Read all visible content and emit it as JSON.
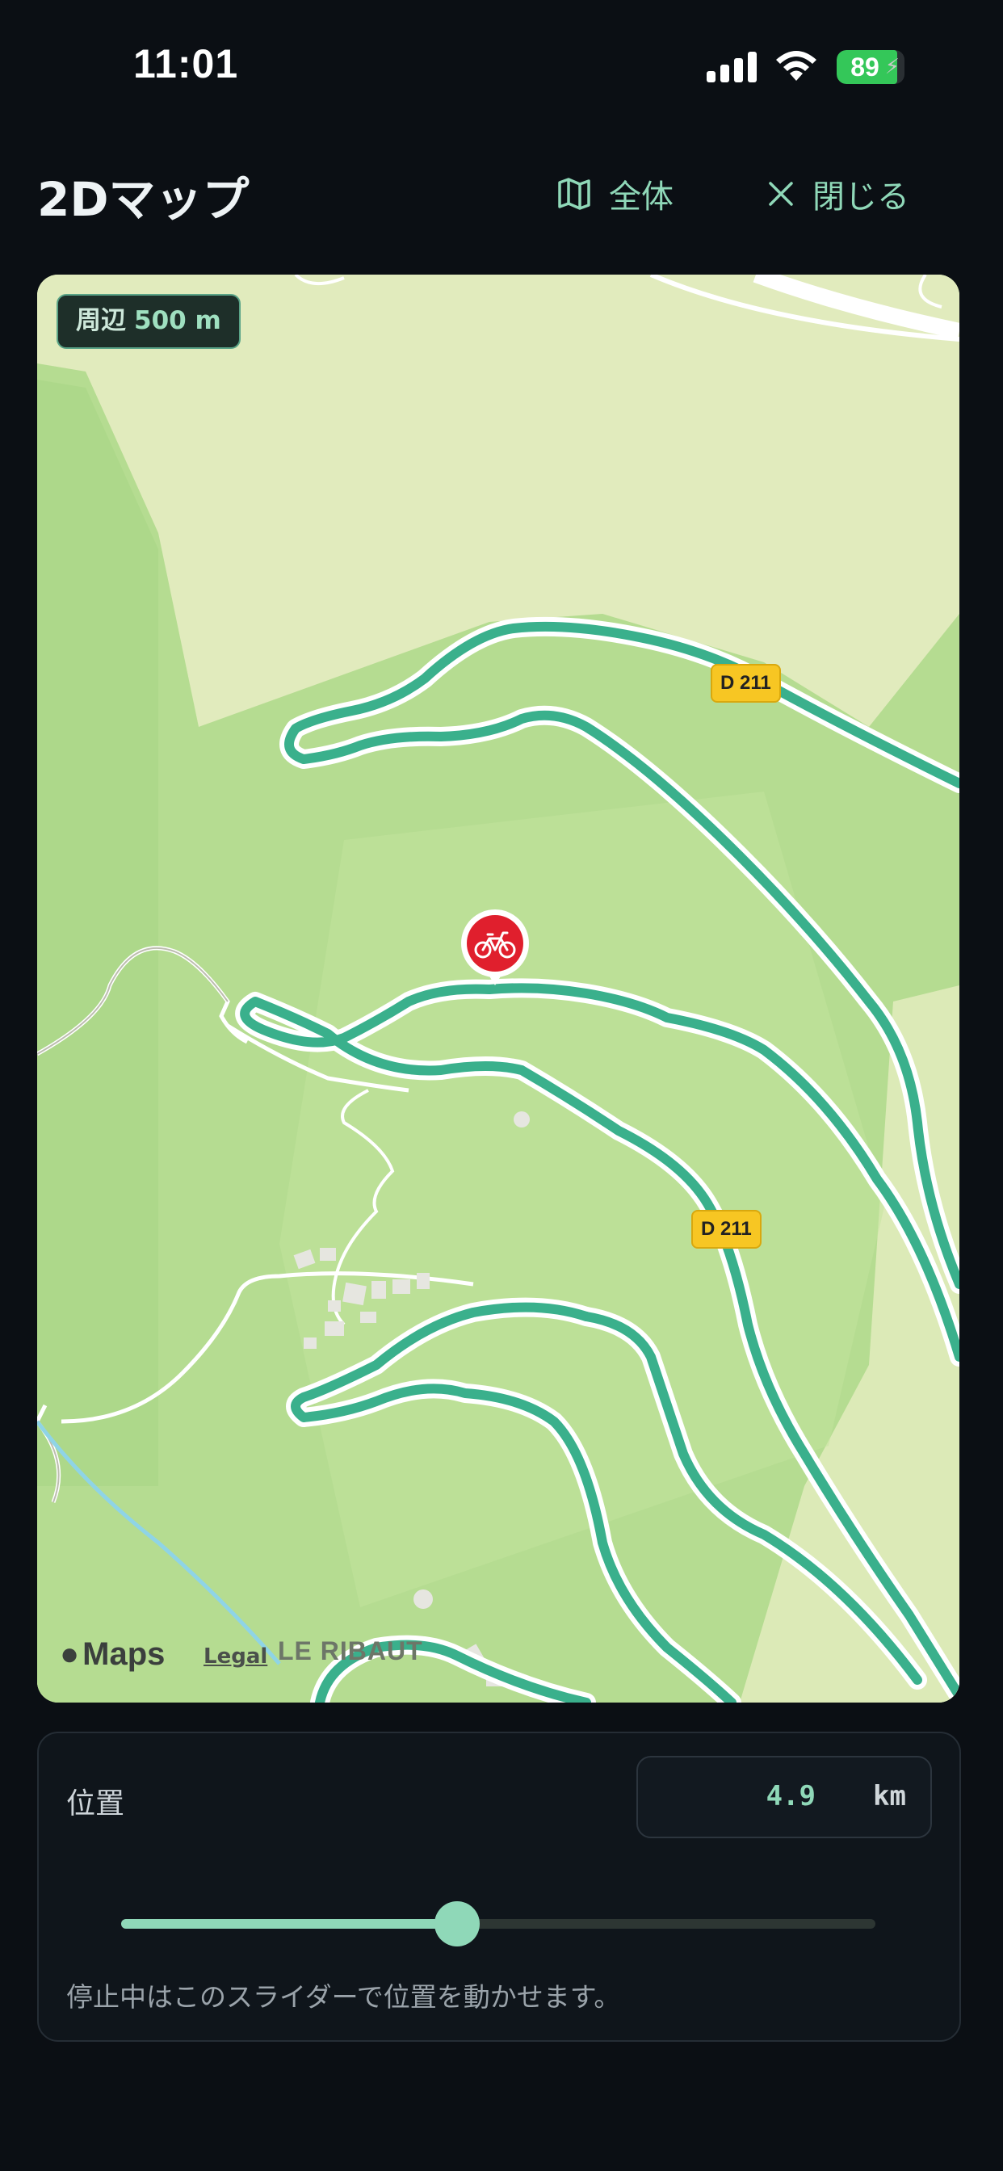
{
  "status_bar": {
    "time": "11:01",
    "battery": "89",
    "battery_level": 0.89
  },
  "header": {
    "title": "2Dマップ",
    "overview_label": "全体",
    "close_label": "閉じる"
  },
  "map": {
    "radius_label": "周辺",
    "radius_value": "500 m",
    "road_labels": [
      "D 211",
      "D 211"
    ],
    "place_label": "LE RIBAUT",
    "maps_logo": "Maps",
    "legal_label": "Legal"
  },
  "panel": {
    "label": "位置",
    "value": "4.9",
    "unit": "km",
    "slider_fraction": 0.445,
    "hint": "停止中はこのスライダーで位置を動かせます。"
  },
  "colors": {
    "accent": "#8fd8b8",
    "route": "#3ab08c",
    "pin": "#e01f2d",
    "road_badge": "#f7c623"
  }
}
